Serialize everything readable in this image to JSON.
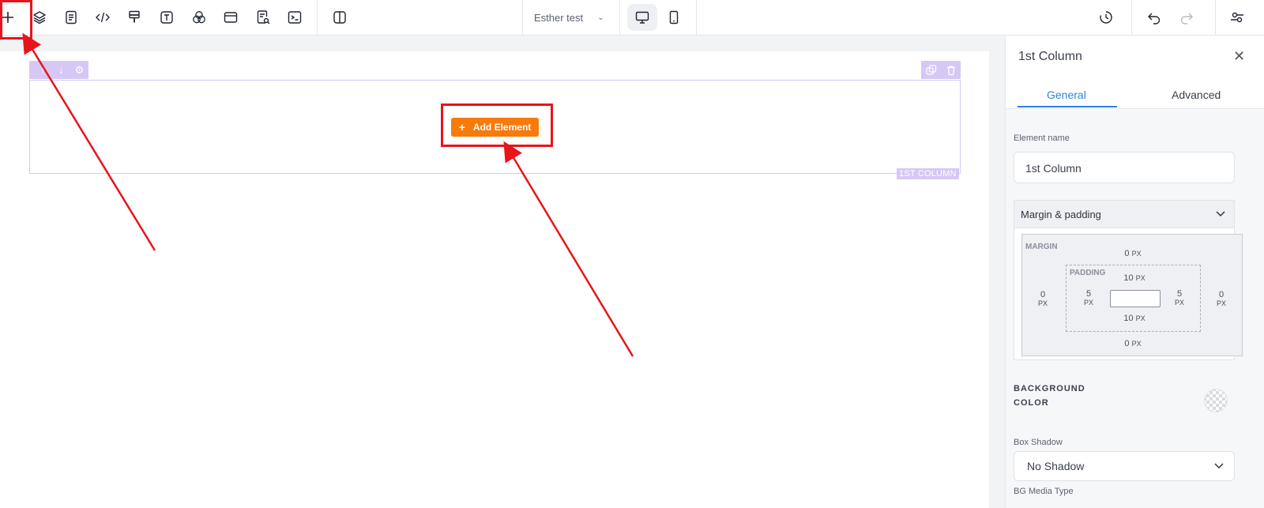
{
  "toolbar": {
    "tools": [
      {
        "name": "add-icon"
      },
      {
        "name": "layers-icon"
      },
      {
        "name": "pages-icon"
      },
      {
        "name": "code-icon"
      },
      {
        "name": "paint-brush-icon"
      },
      {
        "name": "text-icon"
      },
      {
        "name": "color-circles-icon"
      },
      {
        "name": "browser-window-icon"
      },
      {
        "name": "page-search-icon"
      },
      {
        "name": "terminal-icon"
      },
      {
        "name": "split-view-icon"
      }
    ],
    "site_name": "Esther test",
    "devices": [
      "desktop-icon",
      "mobile-icon"
    ],
    "right_tools": [
      "history-icon",
      "undo-icon",
      "redo-icon",
      "settings-icon"
    ]
  },
  "canvas": {
    "add_element_label": "Add Element",
    "column_label": "1ST COLUMN"
  },
  "panel": {
    "title": "1st Column",
    "tabs": [
      "General",
      "Advanced"
    ],
    "active_tab": "General",
    "element_name_label": "Element name",
    "element_name_value": "1st Column",
    "accordion_title": "Margin & padding",
    "margin_label": "MARGIN",
    "padding_label": "PADDING",
    "margin": {
      "top": "0",
      "right": "0",
      "bottom": "0",
      "left": "0"
    },
    "padding": {
      "top": "10",
      "right": "5",
      "bottom": "10",
      "left": "5"
    },
    "unit": "PX",
    "background_color_label": "BACKGROUND COLOR",
    "box_shadow_label": "Box Shadow",
    "box_shadow_value": "No Shadow",
    "bg_media_type_label": "BG Media Type"
  },
  "colors": {
    "accent": "#2f80ed",
    "add_button": "#f77a0b",
    "column_outline": "#d7c7f5",
    "annotation": "#e8141c"
  }
}
